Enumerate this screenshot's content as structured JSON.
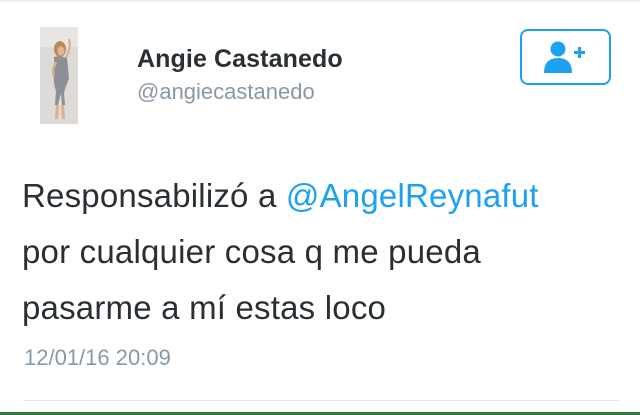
{
  "tweet": {
    "author": {
      "display_name": "Angie Castanedo",
      "handle": "@angiecastanedo"
    },
    "follow_button": {
      "icon": "follow-user-plus-icon"
    },
    "text": {
      "line1_prefix": "Responsabilizó a ",
      "mention": "@AngelReynafut",
      "line2": "por cualquier cosa q me pueda",
      "line3": "pasarme a mí estas loco"
    },
    "timestamp": "12/01/16 20:09"
  },
  "colors": {
    "accent": "#1da1f2",
    "text": "#292f33",
    "muted": "#8899a6"
  }
}
